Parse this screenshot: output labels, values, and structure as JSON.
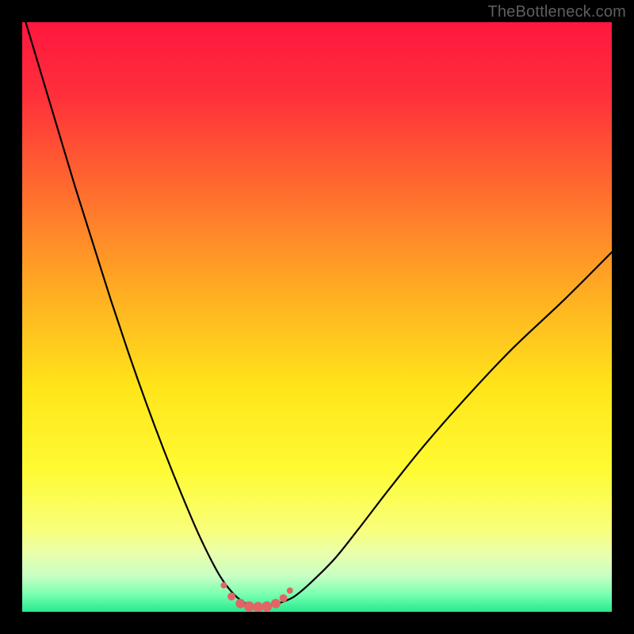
{
  "watermark": "TheBottleneck.com",
  "colors": {
    "frame": "#000000",
    "gradient_stops": [
      {
        "offset": 0.0,
        "color": "#ff173f"
      },
      {
        "offset": 0.12,
        "color": "#ff2e3b"
      },
      {
        "offset": 0.28,
        "color": "#ff6a2f"
      },
      {
        "offset": 0.46,
        "color": "#ffae22"
      },
      {
        "offset": 0.62,
        "color": "#ffe51a"
      },
      {
        "offset": 0.76,
        "color": "#fffb33"
      },
      {
        "offset": 0.86,
        "color": "#f8ff7a"
      },
      {
        "offset": 0.9,
        "color": "#eaffab"
      },
      {
        "offset": 0.94,
        "color": "#c6ffc4"
      },
      {
        "offset": 0.97,
        "color": "#7affb0"
      },
      {
        "offset": 1.0,
        "color": "#26ea8f"
      }
    ],
    "curve": "#000000",
    "marker_fill": "#e06666",
    "marker_stroke": "#d45a5a"
  },
  "chart_data": {
    "type": "line",
    "title": "",
    "xlabel": "",
    "ylabel": "",
    "xlim": [
      0,
      100
    ],
    "ylim": [
      0,
      100
    ],
    "series": [
      {
        "name": "bottleneck-curve",
        "x": [
          0,
          3,
          6,
          9,
          12,
          15,
          18,
          21,
          24,
          27,
          30,
          33,
          35,
          37,
          39,
          41,
          43,
          46,
          49,
          53,
          57,
          62,
          68,
          75,
          83,
          92,
          100
        ],
        "y": [
          102,
          92,
          82,
          72,
          62.5,
          53,
          44,
          35.5,
          27.5,
          20,
          13,
          7,
          4,
          2,
          1,
          1,
          1.3,
          2.5,
          5,
          9,
          14,
          20.5,
          28,
          36,
          44.5,
          53,
          61
        ]
      }
    ],
    "markers": {
      "name": "highlighted-range",
      "x": [
        34.2,
        35.5,
        37.0,
        38.5,
        40.0,
        41.5,
        43.0,
        44.3,
        45.4
      ],
      "y": [
        4.5,
        2.6,
        1.4,
        0.9,
        0.8,
        0.9,
        1.4,
        2.3,
        3.6
      ],
      "r": [
        4.0,
        5.0,
        6.0,
        6.5,
        6.5,
        6.5,
        6.0,
        5.0,
        4.0
      ]
    }
  }
}
